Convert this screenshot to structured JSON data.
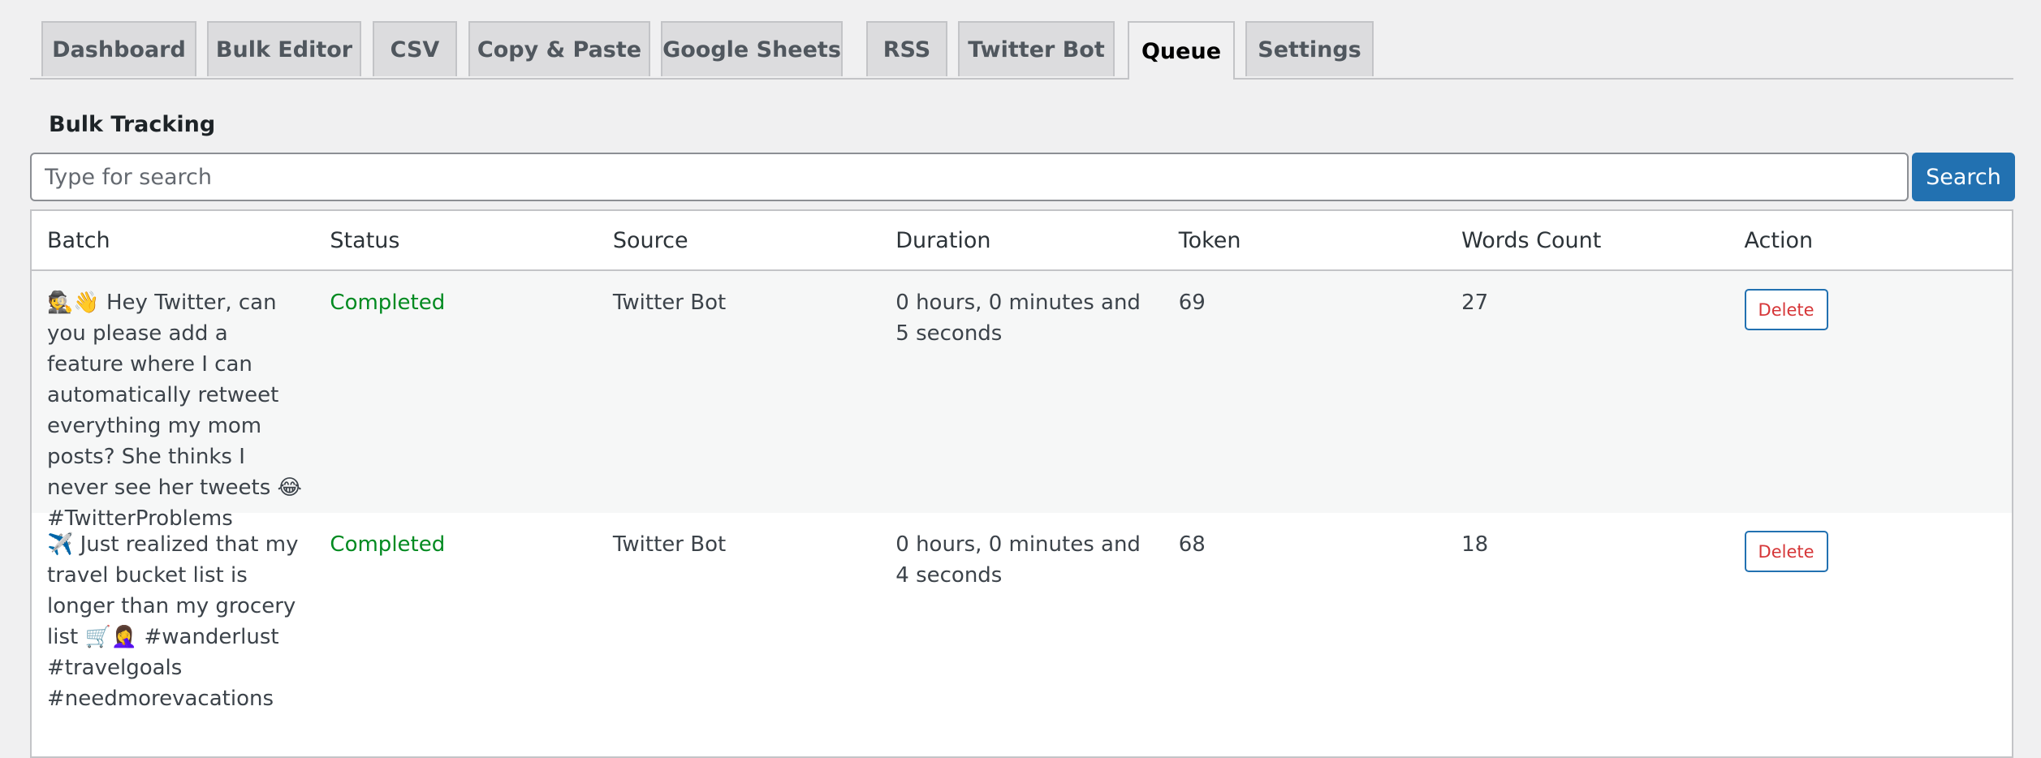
{
  "tabs": [
    {
      "label": "Dashboard",
      "active": false
    },
    {
      "label": "Bulk Editor",
      "active": false
    },
    {
      "label": "CSV",
      "active": false
    },
    {
      "label": "Copy & Paste",
      "active": false
    },
    {
      "label": "Google Sheets",
      "active": false
    },
    {
      "label": "RSS",
      "active": false
    },
    {
      "label": "Twitter Bot",
      "active": false
    },
    {
      "label": "Queue",
      "active": true
    },
    {
      "label": "Settings",
      "active": false
    }
  ],
  "section_title": "Bulk Tracking",
  "search": {
    "placeholder": "Type for search",
    "value": "",
    "button_label": "Search"
  },
  "table": {
    "headers": [
      "Batch",
      "Status",
      "Source",
      "Duration",
      "Token",
      "Words Count",
      "Action"
    ],
    "rows": [
      {
        "batch": "🕵️👋 Hey Twitter, can you please add a feature where I can automatically retweet everything my mom posts? She thinks I never see her tweets 😂 #TwitterProblems",
        "status": "Completed",
        "source": "Twitter Bot",
        "duration": "0 hours, 0 minutes and 5 seconds",
        "token": "69",
        "words_count": "27",
        "action_label": "Delete"
      },
      {
        "batch": "✈️ Just realized that my travel bucket list is longer than my grocery list 🛒🤦‍♀️ #wanderlust #travelgoals #needmorevacations",
        "status": "Completed",
        "source": "Twitter Bot",
        "duration": "0 hours, 0 minutes and 4 seconds",
        "token": "68",
        "words_count": "18",
        "action_label": "Delete"
      }
    ]
  },
  "colors": {
    "accent": "#2271b1",
    "status_completed": "#008a20",
    "delete_text": "#d63638",
    "background": "#f0f0f1"
  }
}
